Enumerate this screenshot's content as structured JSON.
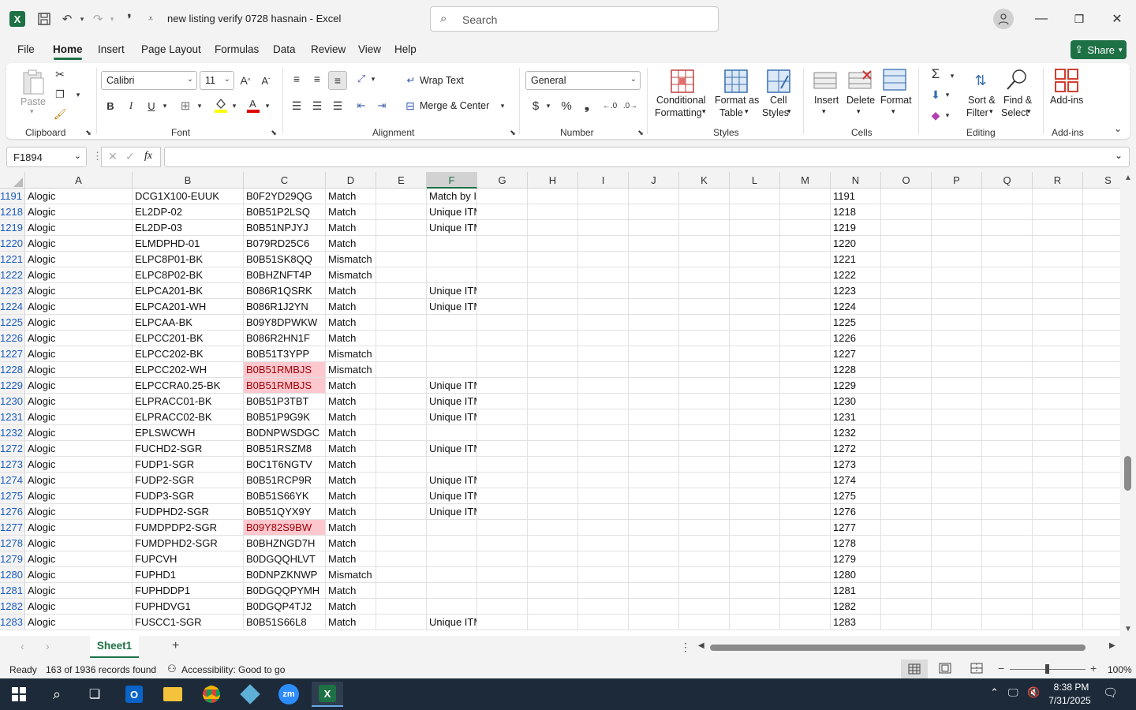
{
  "titlebar": {
    "doc_title": "new listing verify 0728 hasnain  -  Excel",
    "search_placeholder": "Search"
  },
  "menu": {
    "tabs": [
      "File",
      "Home",
      "Insert",
      "Page Layout",
      "Formulas",
      "Data",
      "Review",
      "View",
      "Help"
    ],
    "share": "Share"
  },
  "ribbon": {
    "clipboard": {
      "paste": "Paste",
      "label": "Clipboard"
    },
    "font": {
      "name": "Calibri",
      "size": "11",
      "label": "Font"
    },
    "alignment": {
      "wrap": "Wrap Text",
      "merge": "Merge & Center",
      "label": "Alignment"
    },
    "number": {
      "format": "General",
      "label": "Number"
    },
    "styles": {
      "cond1": "Conditional",
      "cond2": "Formatting",
      "fmt1": "Format as",
      "fmt2": "Table",
      "cell1": "Cell",
      "cell2": "Styles",
      "label": "Styles"
    },
    "cells": {
      "insert": "Insert",
      "delete": "Delete",
      "format": "Format",
      "label": "Cells"
    },
    "editing": {
      "sort1": "Sort &",
      "sort2": "Filter",
      "find1": "Find &",
      "find2": "Select",
      "label": "Editing"
    },
    "addins": {
      "btn": "Add-ins",
      "label": "Add-ins"
    }
  },
  "formula_bar": {
    "name_box": "F1894",
    "fx": "fx",
    "value": ""
  },
  "columns": [
    "A",
    "B",
    "C",
    "D",
    "E",
    "F",
    "G",
    "H",
    "I",
    "J",
    "K",
    "L",
    "M",
    "N",
    "O",
    "P",
    "Q",
    "R",
    "S"
  ],
  "selected_column": "F",
  "rows": [
    {
      "n": "1191",
      "a": "Alogic",
      "b": "DCG1X100-EUUK",
      "c": "B0F2YD29QG",
      "d": "Match",
      "f": "Match by ITM",
      "pink": false
    },
    {
      "n": "1218",
      "a": "Alogic",
      "b": "EL2DP-02",
      "c": "B0B51P2LSQ",
      "d": "Match",
      "f": "Unique ITM",
      "pink": false
    },
    {
      "n": "1219",
      "a": "Alogic",
      "b": "EL2DP-03",
      "c": "B0B51NPJYJ",
      "d": "Match",
      "f": "Unique ITM",
      "pink": false
    },
    {
      "n": "1220",
      "a": "Alogic",
      "b": "ELMDPHD-01",
      "c": "B079RD25C6",
      "d": "Match",
      "f": "",
      "pink": false
    },
    {
      "n": "1221",
      "a": "Alogic",
      "b": "ELPC8P01-BK",
      "c": "B0B51SK8QQ",
      "d": "Mismatch",
      "f": "",
      "pink": false
    },
    {
      "n": "1222",
      "a": "Alogic",
      "b": "ELPC8P02-BK",
      "c": "B0BHZNFT4P",
      "d": "Mismatch",
      "f": "",
      "pink": false
    },
    {
      "n": "1223",
      "a": "Alogic",
      "b": "ELPCA201-BK",
      "c": "B086R1QSRK",
      "d": "Match",
      "f": "Unique ITM",
      "pink": false
    },
    {
      "n": "1224",
      "a": "Alogic",
      "b": "ELPCA201-WH",
      "c": "B086R1J2YN",
      "d": "Match",
      "f": "Unique ITM",
      "pink": false
    },
    {
      "n": "1225",
      "a": "Alogic",
      "b": "ELPCAA-BK",
      "c": "B09Y8DPWKW",
      "d": "Match",
      "f": "",
      "pink": false
    },
    {
      "n": "1226",
      "a": "Alogic",
      "b": "ELPCC201-BK",
      "c": "B086R2HN1F",
      "d": "Match",
      "f": "",
      "pink": false
    },
    {
      "n": "1227",
      "a": "Alogic",
      "b": "ELPCC202-BK",
      "c": "B0B51T3YPP",
      "d": "Mismatch",
      "f": "",
      "pink": false
    },
    {
      "n": "1228",
      "a": "Alogic",
      "b": "ELPCC202-WH",
      "c": "B0B51RMBJS",
      "d": "Mismatch",
      "f": "",
      "pink": true
    },
    {
      "n": "1229",
      "a": "Alogic",
      "b": "ELPCCRA0.25-BK",
      "c": "B0B51RMBJS",
      "d": "Match",
      "f": "Unique ITM",
      "pink": true
    },
    {
      "n": "1230",
      "a": "Alogic",
      "b": "ELPRACC01-BK",
      "c": "B0B51P3TBT",
      "d": "Match",
      "f": "Unique ITM",
      "pink": false
    },
    {
      "n": "1231",
      "a": "Alogic",
      "b": "ELPRACC02-BK",
      "c": "B0B51P9G9K",
      "d": "Match",
      "f": "Unique ITM",
      "pink": false
    },
    {
      "n": "1232",
      "a": "Alogic",
      "b": "EPLSWCWH",
      "c": "B0DNPWSDGC",
      "d": "Match",
      "f": "",
      "pink": false
    },
    {
      "n": "1272",
      "a": "Alogic",
      "b": "FUCHD2-SGR",
      "c": "B0B51RSZM8",
      "d": "Match",
      "f": "Unique ITM",
      "pink": false
    },
    {
      "n": "1273",
      "a": "Alogic",
      "b": "FUDP1-SGR",
      "c": "B0C1T6NGTV",
      "d": "Match",
      "f": "",
      "pink": false
    },
    {
      "n": "1274",
      "a": "Alogic",
      "b": "FUDP2-SGR",
      "c": "B0B51RCP9R",
      "d": "Match",
      "f": "Unique ITM",
      "pink": false
    },
    {
      "n": "1275",
      "a": "Alogic",
      "b": "FUDP3-SGR",
      "c": "B0B51S66YK",
      "d": "Match",
      "f": "Unique ITM",
      "pink": false
    },
    {
      "n": "1276",
      "a": "Alogic",
      "b": "FUDPHD2-SGR",
      "c": "B0B51QYX9Y",
      "d": "Match",
      "f": "Unique ITM",
      "pink": false
    },
    {
      "n": "1277",
      "a": "Alogic",
      "b": "FUMDPDP2-SGR",
      "c": "B09Y82S9BW",
      "d": "Match",
      "f": "",
      "pink": true
    },
    {
      "n": "1278",
      "a": "Alogic",
      "b": "FUMDPHD2-SGR",
      "c": "B0BHZNGD7H",
      "d": "Match",
      "f": "",
      "pink": false
    },
    {
      "n": "1279",
      "a": "Alogic",
      "b": "FUPCVH",
      "c": "B0DGQQHLVT",
      "d": "Match",
      "f": "",
      "pink": false
    },
    {
      "n": "1280",
      "a": "Alogic",
      "b": "FUPHD1",
      "c": "B0DNPZKNWP",
      "d": "Mismatch",
      "f": "",
      "pink": false
    },
    {
      "n": "1281",
      "a": "Alogic",
      "b": "FUPHDDP1",
      "c": "B0DGQQPYMH",
      "d": "Match",
      "f": "",
      "pink": false
    },
    {
      "n": "1282",
      "a": "Alogic",
      "b": "FUPHDVG1",
      "c": "B0DGQP4TJ2",
      "d": "Match",
      "f": "",
      "pink": false
    },
    {
      "n": "1283",
      "a": "Alogic",
      "b": "FUSCC1-SGR",
      "c": "B0B51S66L8",
      "d": "Match",
      "f": "Unique ITM",
      "pink": false
    }
  ],
  "sheets": {
    "active": "Sheet1"
  },
  "status": {
    "ready": "Ready",
    "records": "163 of 1936 records found",
    "accessibility": "Accessibility: Good to go",
    "zoom": "100%"
  },
  "taskbar": {
    "time": "8:38 PM",
    "date": "7/31/2025"
  }
}
